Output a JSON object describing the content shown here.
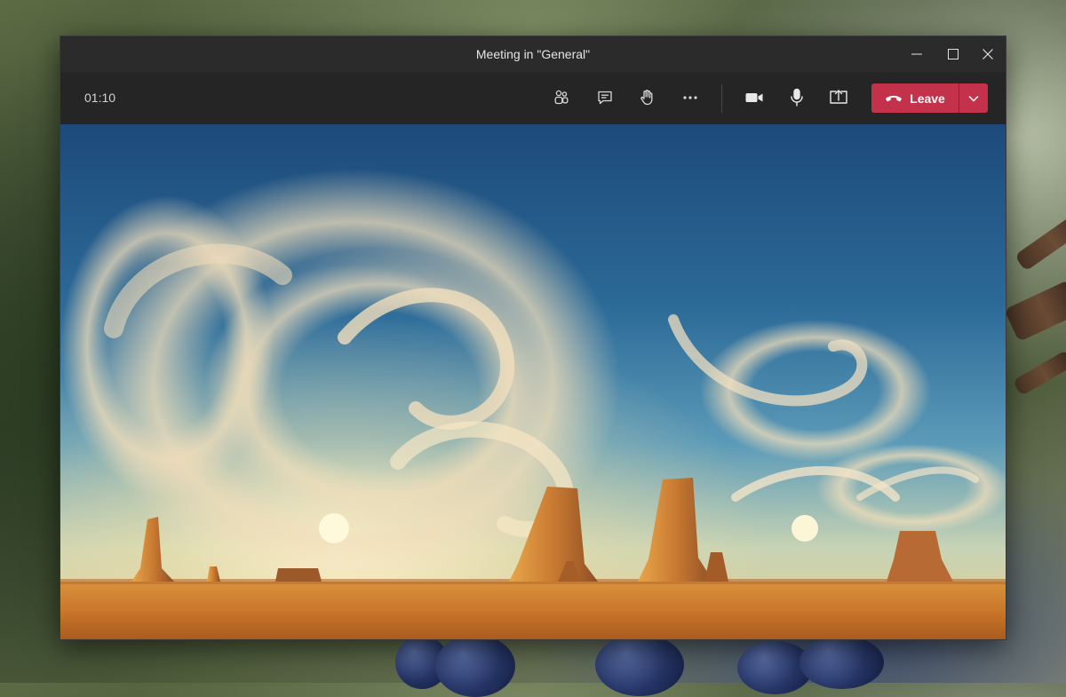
{
  "window": {
    "title": "Meeting in \"General\"",
    "controls": {
      "minimize": "minimize-icon",
      "maximize": "maximize-icon",
      "close": "close-icon"
    }
  },
  "toolbar": {
    "timer": "01:10",
    "buttons": [
      {
        "name": "participants-button",
        "icon": "people-icon"
      },
      {
        "name": "chat-button",
        "icon": "chat-icon"
      },
      {
        "name": "raise-hand-button",
        "icon": "hand-icon"
      },
      {
        "name": "more-actions-button",
        "icon": "more-icon"
      },
      {
        "name": "camera-button",
        "icon": "video-camera-icon"
      },
      {
        "name": "mic-button",
        "icon": "microphone-icon"
      },
      {
        "name": "share-button",
        "icon": "share-screen-icon"
      }
    ],
    "leave": {
      "label": "Leave",
      "icon": "hang-up-icon",
      "dropdown": "chevron-down-icon"
    }
  },
  "stage": {
    "content": "background-video"
  },
  "colors": {
    "titlebar": "#2b2b2b",
    "toolbar": "#252525",
    "leave_button": "#c4314b",
    "text": "#e6e6e6"
  }
}
